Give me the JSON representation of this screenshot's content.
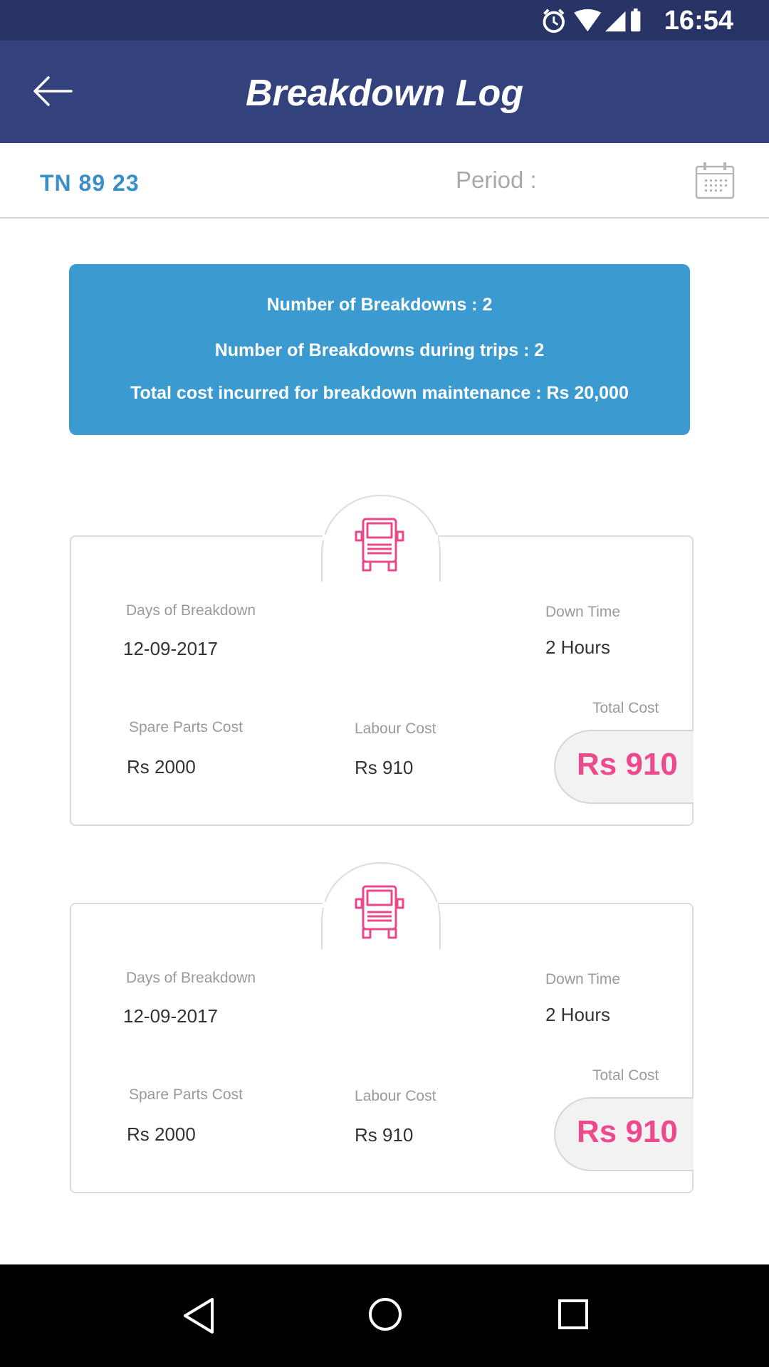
{
  "status_bar": {
    "time": "16:54"
  },
  "app_bar": {
    "title": "Breakdown Log"
  },
  "filter": {
    "vehicle_number": "TN 89 23",
    "period_label": "Period :"
  },
  "summary": {
    "breakdowns": "Number of Breakdowns : 2",
    "breakdowns_during_trips": "Number of Breakdowns during trips : 2",
    "total_cost": "Total cost incurred for breakdown maintenance : Rs 20,000"
  },
  "labels": {
    "days_of_breakdown": "Days of Breakdown",
    "down_time": "Down Time",
    "spare_parts_cost": "Spare Parts Cost",
    "labour_cost": "Labour Cost",
    "total_cost": "Total Cost"
  },
  "records": [
    {
      "date": "12-09-2017",
      "down_time": "2 Hours",
      "spare_parts_cost": "Rs 2000",
      "labour_cost": "Rs 910",
      "total_cost": "Rs 910"
    },
    {
      "date": "12-09-2017",
      "down_time": "2 Hours",
      "spare_parts_cost": "Rs 2000",
      "labour_cost": "Rs 910",
      "total_cost": "Rs 910"
    }
  ],
  "colors": {
    "status_bar": "#283366",
    "app_bar": "#33427c",
    "summary_bg": "#3b9bd1",
    "accent_blue": "#3a8fc9",
    "accent_pink": "#ec4a8c"
  },
  "icons": {
    "back": "back-arrow-icon",
    "calendar": "calendar-icon",
    "truck": "truck-icon",
    "nav_back": "nav-back-icon",
    "nav_home": "nav-home-icon",
    "nav_recents": "nav-recents-icon"
  }
}
